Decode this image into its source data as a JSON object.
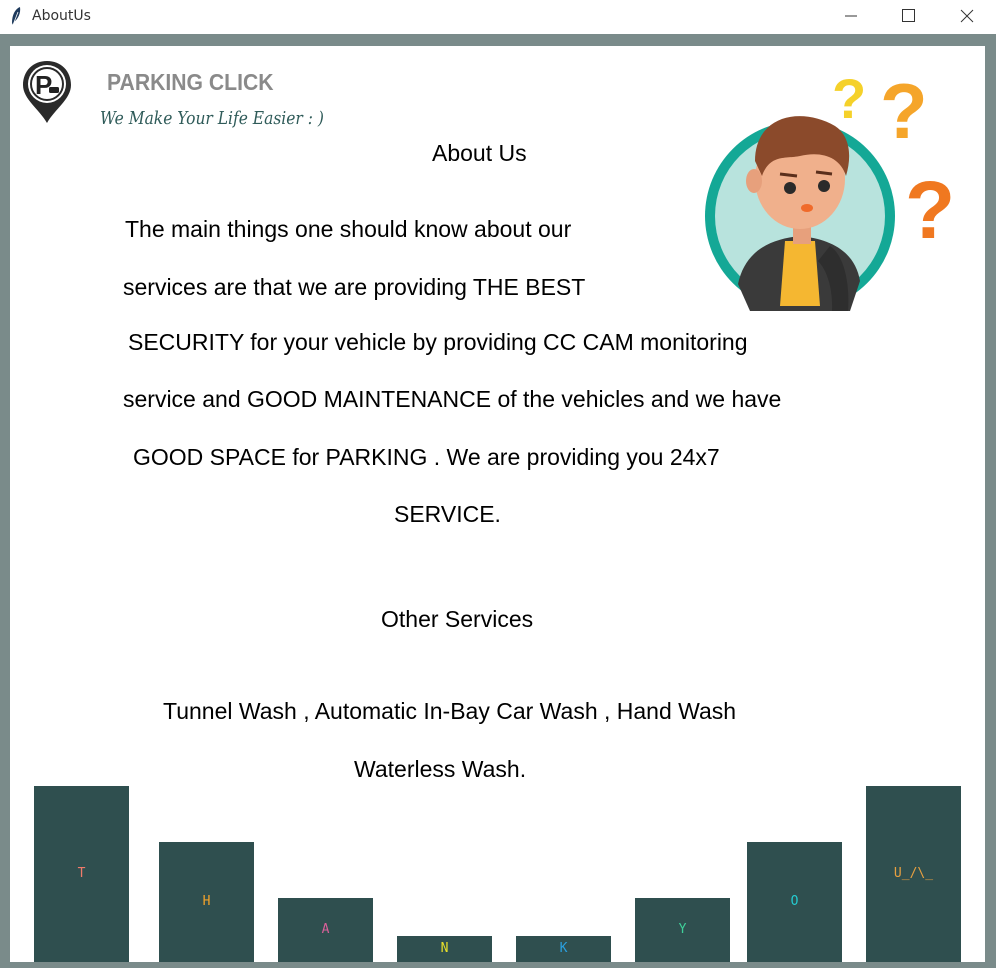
{
  "window": {
    "title": "AboutUs",
    "app_icon": "feather-icon",
    "controls": [
      "minimize-icon",
      "maximize-icon",
      "close-icon"
    ]
  },
  "brand": {
    "name": "PARKING CLICK",
    "tagline": "We Make Your Life Easier : )",
    "logo_letter": "P",
    "logo_icon": "parking-pin-icon"
  },
  "about": {
    "heading": "About Us",
    "lines": [
      "The main things one should know about our",
      "services are that we are providing THE BEST",
      "SECURITY for your vehicle by providing CC CAM monitoring",
      "service and GOOD MAINTENANCE of the vehicles and we have",
      "GOOD SPACE for PARKING . We are providing you 24x7",
      "SERVICE."
    ]
  },
  "services": {
    "heading": "Other Services",
    "lines": [
      "Tunnel Wash , Automatic In-Bay Car Wash , Hand Wash",
      "Waterless Wash."
    ]
  },
  "illustration": {
    "icon": "confused-person-with-question-marks-icon"
  },
  "thanks_bars": [
    {
      "label": "T",
      "color": "#f07b6b"
    },
    {
      "label": "H",
      "color": "#f3a32a"
    },
    {
      "label": "A",
      "color": "#d9609a"
    },
    {
      "label": "N",
      "color": "#e8e02a"
    },
    {
      "label": "K",
      "color": "#2aa0e0"
    },
    {
      "label": "Y",
      "color": "#3fd19a"
    },
    {
      "label": "O",
      "color": "#25cbd0"
    },
    {
      "label": "U_/\\_",
      "color": "#e8a040"
    }
  ],
  "colors": {
    "bar": "#2f4f4f",
    "frame": "#7a8b8a",
    "tagline": "#2f5b59"
  }
}
